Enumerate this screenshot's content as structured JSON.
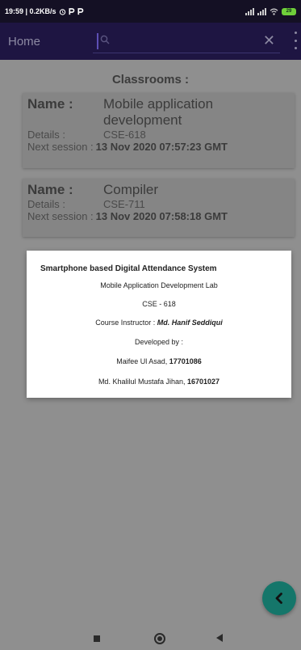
{
  "status_bar": {
    "time_speed": "19:59 | 0.2KB/s",
    "icons": [
      "alarm-icon",
      "p-app-icon",
      "p-app-icon"
    ],
    "battery": "29"
  },
  "app_bar": {
    "title": "Home",
    "search_placeholder": "",
    "clear_symbol": "✕"
  },
  "section_title": "Classrooms :",
  "classrooms": [
    {
      "name_label": "Name :",
      "name": "Mobile application development",
      "details_label": "Details :",
      "details": "CSE-618",
      "next_label": "Next session :",
      "next_session": "13 Nov 2020 07:57:23 GMT"
    },
    {
      "name_label": "Name :",
      "name": "Compiler",
      "details_label": "Details :",
      "details": "CSE-711",
      "next_label": "Next session :",
      "next_session": "13 Nov 2020 07:58:18 GMT"
    }
  ],
  "about_dialog": {
    "title": "Smartphone based Digital Attendance System",
    "lab": "Mobile Application Development Lab",
    "course": "CSE - 618",
    "instructor_label": "Course Instructor : ",
    "instructor_name": "Md. Hanif Seddiqui",
    "developed_by": "Developed by :",
    "dev1_name": "Maifee Ul Asad, ",
    "dev1_id": "17701086",
    "dev2_name": "Md. Khalilul Mustafa Jihan, ",
    "dev2_id": "16701027"
  },
  "colors": {
    "status_bar": "#141024",
    "app_bar": "#1e1542",
    "scrim_background": "#8f8f8f",
    "fab": "#15766a",
    "battery": "#6fcf3a"
  }
}
